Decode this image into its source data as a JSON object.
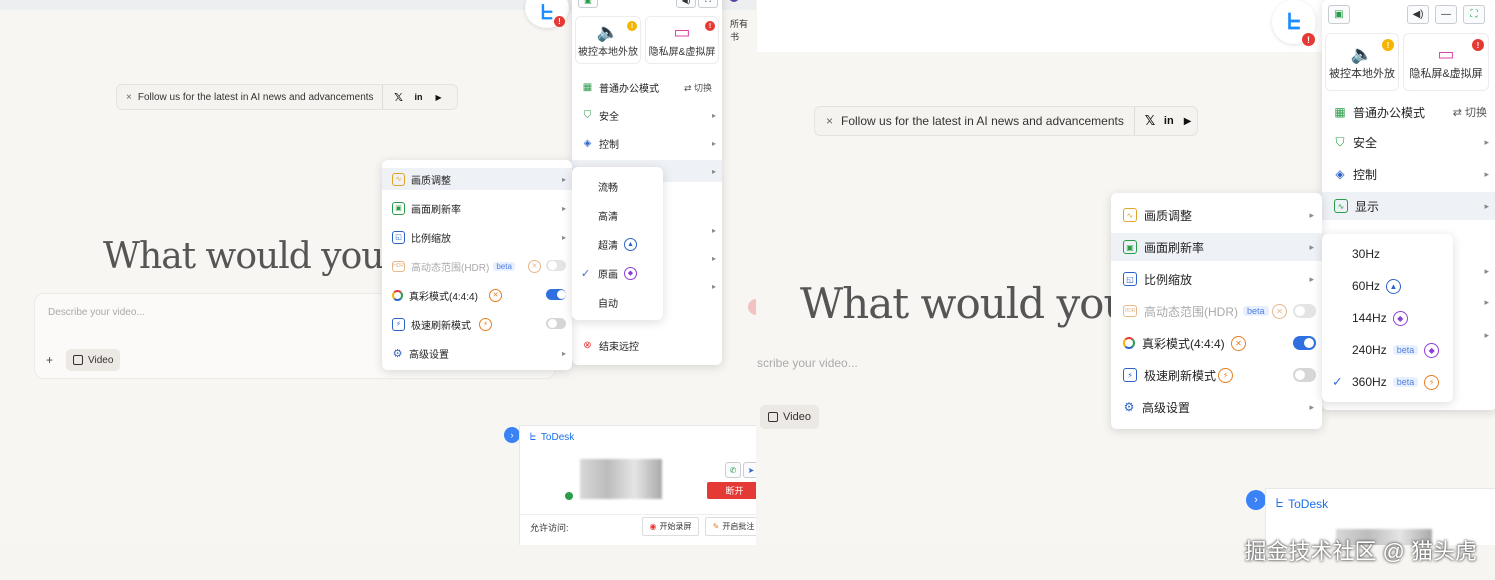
{
  "banner": {
    "text": "Follow us for the latest in AI news and advancements",
    "close_glyph": "×",
    "x_glyph": "𝕏",
    "linkedin_glyph": "in",
    "youtube_glyph": "▶"
  },
  "hero": {
    "text": "What would you like"
  },
  "prompt": {
    "placeholder_left": "Describe your video...",
    "placeholder_right": "scribe your video...",
    "plus": "+",
    "video_chip": "Video"
  },
  "remote_toolbar": {
    "all_label": "所有书",
    "cards": [
      {
        "label": "被控本地外放",
        "icon": "speaker-icon",
        "badge": "!",
        "badge_color": "#f4b400"
      },
      {
        "label": "隐私屏&虚拟屏",
        "icon": "privacy-screen-icon",
        "badge": "!",
        "badge_color": "#e53935"
      }
    ],
    "mode": {
      "label": "普通办公模式",
      "switch": "切换"
    },
    "items": [
      "安全",
      "控制",
      "显示"
    ],
    "end_remote": "结束远控",
    "colors": {
      "accent": "#1a8cff",
      "danger": "#e53935",
      "toggle_on": "#2f6fdf"
    }
  },
  "display_menu": {
    "items": [
      {
        "label": "画质调整",
        "icon": "picture-quality-icon"
      },
      {
        "label": "画面刷新率",
        "icon": "refresh-rate-icon"
      },
      {
        "label": "比例缩放",
        "icon": "scale-icon"
      },
      {
        "label": "高动态范围(HDR)",
        "icon": "hdr-icon",
        "beta": "beta",
        "disabled": true,
        "toggle": false
      },
      {
        "label": "真彩模式(4:4:4)",
        "icon": "true-color-icon",
        "toggle": true
      },
      {
        "label": "极速刷新模式",
        "icon": "fast-refresh-icon",
        "toggle": false
      },
      {
        "label": "高级设置",
        "icon": "advanced-settings-icon"
      }
    ]
  },
  "quality_menu": {
    "options": [
      "流畅",
      "高清",
      "超清",
      "原画",
      "自动"
    ],
    "selected": "原画"
  },
  "refresh_menu": {
    "options": [
      {
        "label": "30Hz"
      },
      {
        "label": "60Hz",
        "badge": "blue"
      },
      {
        "label": "144Hz",
        "badge": "purple"
      },
      {
        "label": "240Hz",
        "beta": "beta",
        "badge": "purple"
      },
      {
        "label": "360Hz",
        "beta": "beta",
        "badge": "orange"
      }
    ],
    "selected": "360Hz"
  },
  "todesk": {
    "title": "ToDesk",
    "disconnect": "断开",
    "allow_access": "允许访问:",
    "record": "开始录屏",
    "annotate": "开启批注"
  },
  "watermark": "掘金技术社区 @ 猫头虎"
}
